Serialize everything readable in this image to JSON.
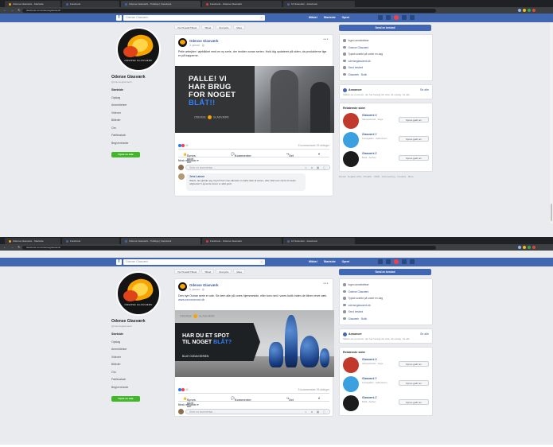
{
  "browser": {
    "tabs": [
      "Odense Glasværk - Startside",
      "Facebook",
      "Odense Glasværk - Tidslinje | Facebook",
      "Facebook - Odense Glasværk",
      "10 Sekunder - Facebook"
    ],
    "url": "facebook.com/odenseglasvaerk/",
    "nav_glyphs": "← → ↻"
  },
  "fb": {
    "logo": "f",
    "search_placeholder": "Odense Glasværk",
    "search_icon": "search-icon",
    "nav": [
      "Mikkel",
      "Startside",
      "Opret"
    ]
  },
  "page": {
    "name": "Odense Glasværk",
    "handle": "@odenseglasvaerk",
    "avatar_text": "ODENSE GLASVÆRK",
    "nav": [
      "Startside",
      "Opslag",
      "Anmeldelser",
      "Videoer",
      "Billeder",
      "Om",
      "Fællesskab",
      "Begivenheder"
    ],
    "cta": "Opret en side"
  },
  "feed_tabs": [
    "Vis Tilmeldt Tilbud",
    "Tilbud",
    "Find jobs",
    "Mere"
  ],
  "posts": [
    {
      "author": "Odense Glasværk",
      "date": "4. januar · ",
      "text": "Pelle arbejder i øjeblikket med en ny serie, der hedder ocean serien. Hold dig opdateret på siden, da produkterne lige er på trapperne.",
      "image_headline_1": "PALLE! VI",
      "image_headline_2": "HAR BRUG",
      "image_headline_3": "FOR NOGET",
      "image_headline_blue": "BLÅT!!",
      "image_logo": "ODENSE GLASVÆRK",
      "reactions": "40",
      "counts": "5 kommentarer 29 delinger",
      "actions": [
        "Synes godt om",
        "Kommenter",
        "Del"
      ],
      "sort": "Mest relevante ▾",
      "comment_placeholder": "Skriv en kommentar ...",
      "comment_author": "Jens Larsen",
      "comment_text": "Wauw, det glæder jeg mig til! Kan man allerede nu købe dele af serien, eller skal man vente til næste udgivelse? Lignende farver er altid godt."
    },
    {
      "author": "Odense Glasværk",
      "date": "5. januar · ",
      "text": "Den nye Ocean serie er ude. Se dem alle på vores hjemmeside, eller kom ned i vores butik inden de bliver revet væk.",
      "link": "www.xxxxxxxxxxx.dk",
      "image_logo": "ODENSE GLASVÆRK",
      "image_headline_1": "HAR DU ET SPOT",
      "image_headline_2": "TIL NOGET ",
      "image_headline_blue": "BLÅT?",
      "image_sub": "BLUE OCEAN SERIEN",
      "reactions": "40",
      "counts": "5 kommentarer 29 delinger",
      "actions": [
        "Synes godt om",
        "Kommenter",
        "Del"
      ],
      "sort": "Mest relevante ▾",
      "comment_placeholder": "Skriv en kommentar ..."
    }
  ],
  "right": {
    "cta": "Send en besked",
    "about": [
      "Ingen anmeldelser",
      "Odense Glasværk",
      "Typisk svartid på under en dag",
      "odenseglasvaerk.dk",
      "Send besked",
      "Glasværk · Butik"
    ],
    "related_title": "Relaterede sider",
    "related_more": "Se alle",
    "related": [
      {
        "name": "Glasværk X",
        "sub": "Glasvarebutik · Køge",
        "like": "Synes godt om"
      },
      {
        "name": "Glasværk Y",
        "sub": "Kunstgalleri · København",
        "like": "Synes godt om"
      },
      {
        "name": "Glasværk Z",
        "sub": "Butik · Aarhus",
        "like": "Synes godt om"
      }
    ],
    "ad_title": "Annoncer",
    "ad_text": "Sådan ser personer, der har besøgt din side, dit opslag. Se alle",
    "footer": "Dansk · English (US) · Privatliv · Vilkår · Annoncering · Cookies · Mere"
  },
  "chat": {
    "label": "Odense Glasværk",
    "label2": "Chat (26)"
  },
  "taskbar": {
    "clock": "14:16 08-01-2019"
  },
  "colors": {
    "fb_blue": "#4267b2",
    "link": "#385898",
    "accent_blue": "#2f80ff",
    "flame": "#f7a400",
    "like_green": "#42b72a"
  }
}
